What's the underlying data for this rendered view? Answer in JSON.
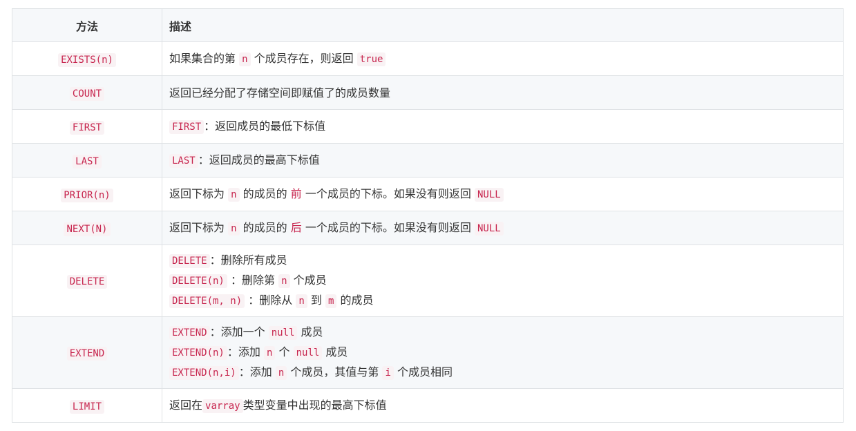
{
  "table": {
    "headers": {
      "method": "方法",
      "description": "描述"
    },
    "rows": {
      "exists": {
        "method": "EXISTS(n)",
        "d1": "如果集合的第",
        "c1": "n",
        "d2": "个成员存在，则返回",
        "c2": "true"
      },
      "count": {
        "method": "COUNT",
        "d1": "返回已经分配了存储空间即赋值了的成员数量"
      },
      "first": {
        "method": "FIRST",
        "c1": "FIRST",
        "d1": "：返回成员的最低下标值"
      },
      "last": {
        "method": "LAST",
        "c1": "LAST",
        "d1": "：返回成员的最高下标值"
      },
      "prior": {
        "method": "PRIOR(n)",
        "d1": "返回下标为",
        "c1": "n",
        "d2": "的成员的",
        "h1": "前",
        "d3": "一个成员的下标。如果没有则返回",
        "c2": "NULL"
      },
      "next": {
        "method": "NEXT(N)",
        "d1": "返回下标为",
        "c1": "n",
        "d2": "的成员的",
        "h1": "后",
        "d3": "一个成员的下标。如果没有则返回",
        "c2": "NULL"
      },
      "delete": {
        "method": "DELETE",
        "l1c1": "DELETE",
        "l1d1": "：删除所有成员",
        "l2c1": "DELETE(n)",
        "l2d1": "：删除第",
        "l2c2": "n",
        "l2d2": "个成员",
        "l3c1": "DELETE(m, n)",
        "l3d1": "：删除从",
        "l3c2": "n",
        "l3d2": "到",
        "l3c3": "m",
        "l3d3": "的成员"
      },
      "extend": {
        "method": "EXTEND",
        "l1c1": "EXTEND",
        "l1d1": "：添加一个",
        "l1c2": "null",
        "l1d2": "成员",
        "l2c1": "EXTEND(n)",
        "l2d1": "：添加",
        "l2c2": "n",
        "l2d2": "个",
        "l2c3": "null",
        "l2d3": "成员",
        "l3c1": "EXTEND(n,i)",
        "l3d1": "：添加",
        "l3c2": "n",
        "l3d2": "个成员，其值与第",
        "l3c3": "i",
        "l3d3": "个成员相同"
      },
      "limit": {
        "method": "LIMIT",
        "d1": "返回在",
        "c1": "varray",
        "d2": "类型变量中出现的最高下标值"
      }
    }
  }
}
